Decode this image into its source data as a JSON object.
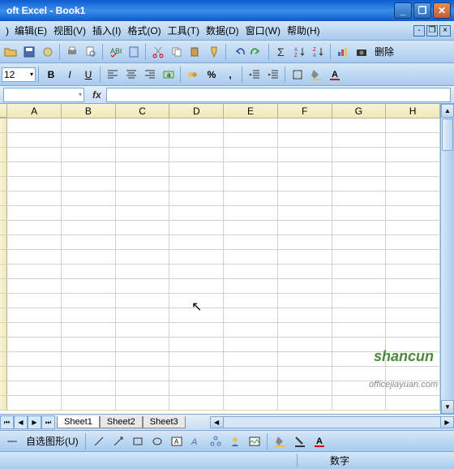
{
  "window": {
    "title": "oft Excel - Book1"
  },
  "menu": {
    "edit": "编辑(E)",
    "view": "视图(V)",
    "insert": "插入(I)",
    "format": "格式(O)",
    "tools": "工具(T)",
    "data": "数据(D)",
    "window": "窗口(W)",
    "help": "帮助(H)"
  },
  "toolbar1": {
    "delete_label": "删除"
  },
  "toolbar2": {
    "font_size": "12"
  },
  "formula": {
    "name_box": "",
    "fx": "fx"
  },
  "columns": [
    "A",
    "B",
    "C",
    "D",
    "E",
    "F",
    "G",
    "H"
  ],
  "sheets": {
    "s1": "Sheet1",
    "s2": "Sheet2",
    "s3": "Sheet3"
  },
  "drawbar": {
    "autoshapes": "自选图形(U)"
  },
  "status": {
    "mode": "数字"
  },
  "watermark": {
    "url": "officejiayuan.com",
    "logo": "shancun"
  }
}
